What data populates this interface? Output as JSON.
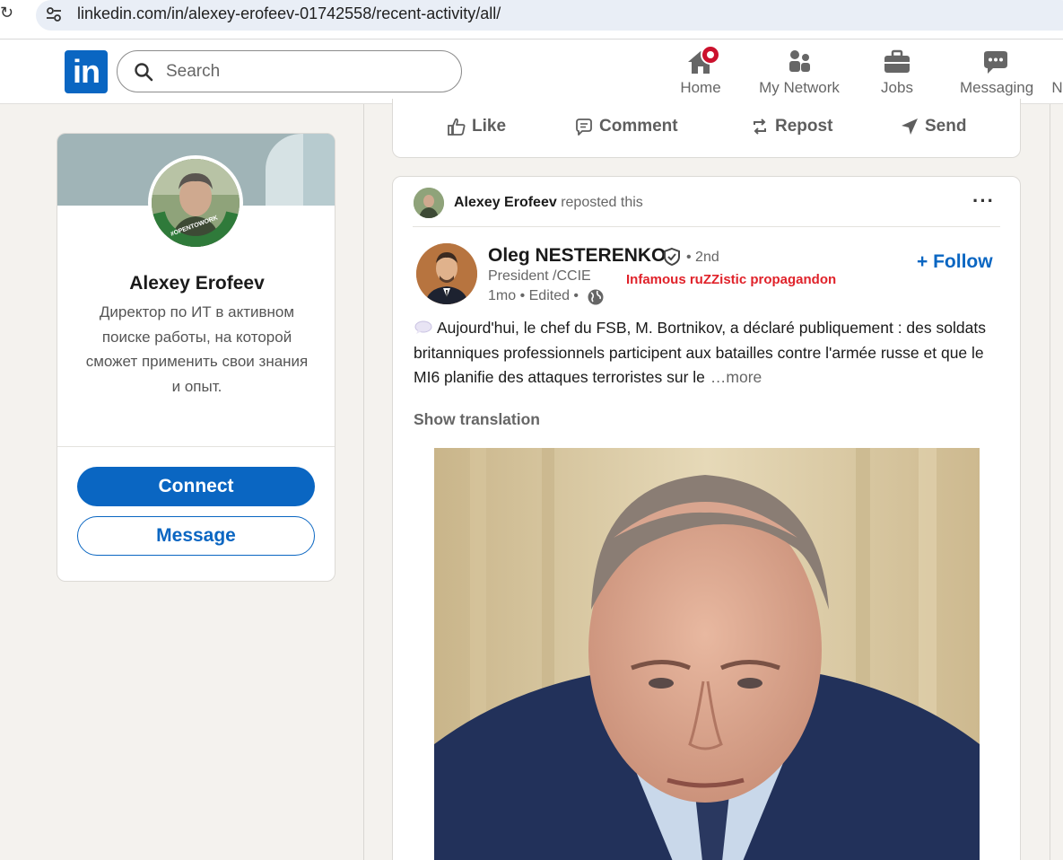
{
  "browser": {
    "url": "linkedin.com/in/alexey-erofeev-01742558/recent-activity/all/"
  },
  "header": {
    "logo": "in",
    "search_placeholder": "Search",
    "nav": [
      {
        "label": "Home",
        "icon": "home-icon"
      },
      {
        "label": "My Network",
        "icon": "network-icon"
      },
      {
        "label": "Jobs",
        "icon": "briefcase-icon"
      },
      {
        "label": "Messaging",
        "icon": "messaging-icon"
      },
      {
        "label": "N",
        "icon": "notifications-icon"
      }
    ],
    "accent": "#0a66c2",
    "badge_color": "#cb112d"
  },
  "profile": {
    "name": "Alexey Erofeev",
    "headline": "Директор по ИТ в активном поиске работы, на которой сможет применить свои знания и опыт.",
    "avatar_frame_text": "#OPENTOWORK",
    "connect_label": "Connect",
    "message_label": "Message"
  },
  "actions": [
    {
      "label": "Like",
      "icon": "like-icon"
    },
    {
      "label": "Comment",
      "icon": "comment-icon"
    },
    {
      "label": "Repost",
      "icon": "repost-icon"
    },
    {
      "label": "Send",
      "icon": "send-icon"
    }
  ],
  "post": {
    "reposter_name": "Alexey Erofeev",
    "reposted_text": "reposted this",
    "more_menu": "···",
    "author_name": "Oleg NESTERENKO",
    "degree": "• 2nd",
    "author_title": "President /CCIE",
    "annotation": "Infamous ruZZistic propagandon",
    "meta": "1mo • Edited •",
    "follow_label": "+ Follow",
    "text": "Aujourd'hui, le chef du FSB, M. Bortnikov, a déclaré publiquement : des soldats britanniques professionnels participent aux batailles contre l'armée russe et que le MI6 planifie des attaques terroristes sur le",
    "more_label": "…more",
    "show_translation": "Show translation",
    "annotation_color": "#e0222a"
  }
}
